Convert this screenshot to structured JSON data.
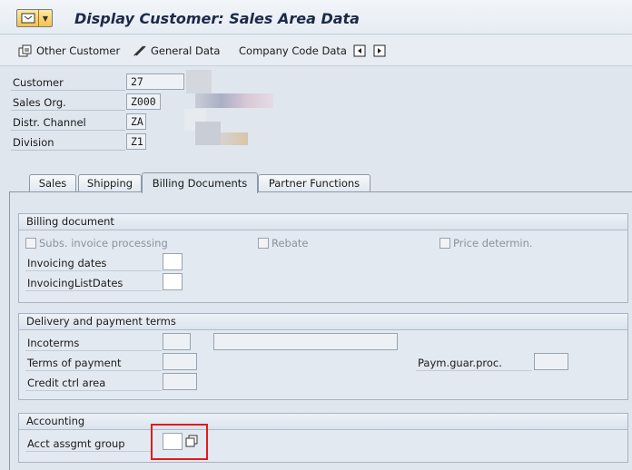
{
  "window": {
    "title": "Display Customer: Sales Area Data"
  },
  "toolbar": {
    "items": [
      {
        "label": "Other Customer",
        "icon": "other-customer-icon"
      },
      {
        "label": "General Data",
        "icon": "general-data-icon"
      },
      {
        "label": "Company Code Data",
        "icon": ""
      }
    ],
    "extra_icons": [
      "previous-entry-icon",
      "next-entry-icon"
    ]
  },
  "header": {
    "fields": [
      {
        "label": "Customer",
        "value": "27"
      },
      {
        "label": "Sales Org.",
        "value": "Z000"
      },
      {
        "label": "Distr. Channel",
        "value": "ZA"
      },
      {
        "label": "Division",
        "value": "Z1"
      }
    ]
  },
  "tabs": [
    {
      "label": "Sales",
      "active": false
    },
    {
      "label": "Shipping",
      "active": false
    },
    {
      "label": "Billing Documents",
      "active": true
    },
    {
      "label": "Partner Functions",
      "active": false
    }
  ],
  "billing_document": {
    "title": "Billing document",
    "checkboxes": [
      {
        "label": "Subs. invoice processing",
        "checked": false
      },
      {
        "label": "Rebate",
        "checked": false
      },
      {
        "label": "Price determin.",
        "checked": false
      }
    ],
    "invoicing_dates_label": "Invoicing dates",
    "invoicing_list_dates_label": "InvoicingListDates"
  },
  "delivery_payment": {
    "title": "Delivery and payment terms",
    "incoterms_label": "Incoterms",
    "terms_of_payment_label": "Terms of payment",
    "credit_ctrl_area_label": "Credit ctrl area",
    "paym_guar_label": "Paym.guar.proc."
  },
  "accounting": {
    "title": "Accounting",
    "acct_assgmt_group_label": "Acct assgmt group"
  },
  "colors": {
    "highlight": "#e21a1a",
    "title_text": "#1b2a48"
  }
}
